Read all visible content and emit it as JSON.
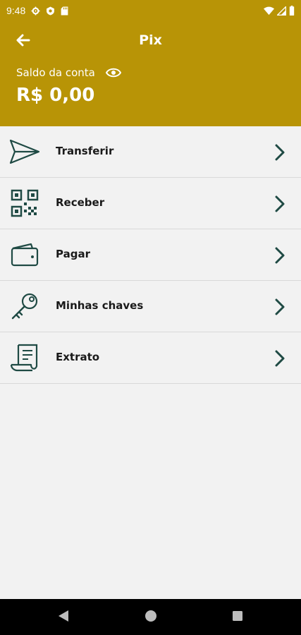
{
  "status_bar": {
    "time": "9:48",
    "icons": [
      "settings-icon",
      "shield-icon",
      "sd-card-icon",
      "wifi-icon",
      "signal-icon",
      "battery-icon"
    ]
  },
  "header": {
    "title": "Pix",
    "back_icon": "arrow-left-icon",
    "balance_label": "Saldo da conta",
    "visibility_icon": "eye-icon",
    "balance_value": "R$ 0,00"
  },
  "menu": {
    "items": [
      {
        "label": "Transferir",
        "icon": "send-icon"
      },
      {
        "label": "Receber",
        "icon": "qr-code-icon"
      },
      {
        "label": "Pagar",
        "icon": "wallet-icon"
      },
      {
        "label": "Minhas chaves",
        "icon": "key-icon"
      },
      {
        "label": "Extrato",
        "icon": "receipt-icon"
      }
    ],
    "chevron_icon": "chevron-right-icon"
  },
  "nav_bar": {
    "buttons": [
      "back-triangle-icon",
      "home-circle-icon",
      "recents-square-icon"
    ]
  },
  "colors": {
    "brand": "#b89406",
    "background": "#f2f2f2",
    "icon_dark": "#1f4a44",
    "text": "#1a1a1a",
    "divider": "#d9d9d9"
  }
}
